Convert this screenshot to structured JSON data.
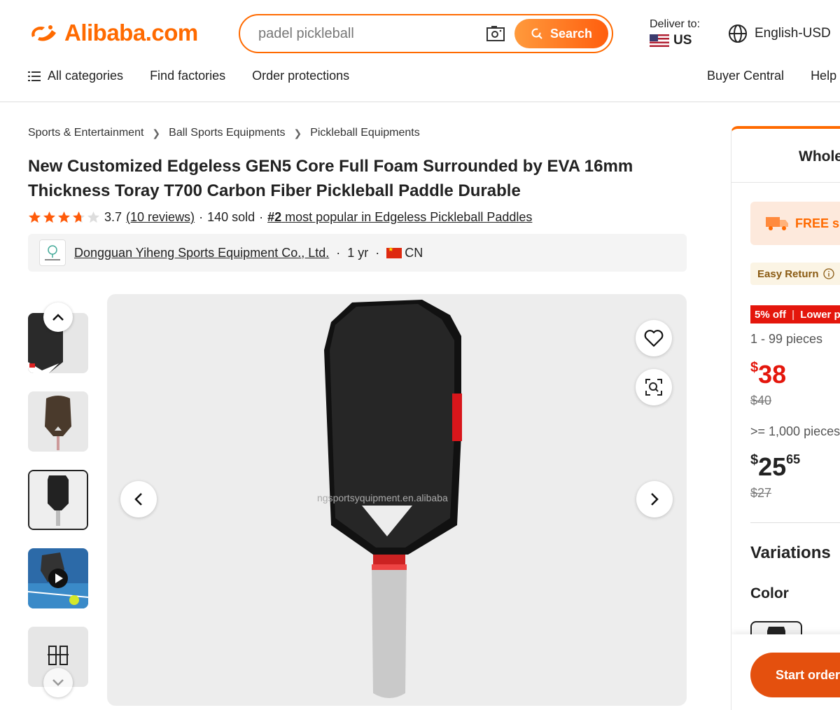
{
  "header": {
    "logo_text": "Alibaba.com",
    "search": {
      "placeholder": "padel pickleball",
      "button_label": "Search"
    },
    "deliver": {
      "label": "Deliver to:",
      "country": "US"
    },
    "language": "English-USD",
    "nav": {
      "all_categories": "All categories",
      "find_factories": "Find factories",
      "order_protections": "Order protections",
      "buyer_central": "Buyer Central",
      "help": "Help"
    }
  },
  "breadcrumb": [
    "Sports & Entertainment",
    "Ball Sports Equipments",
    "Pickleball Equipments"
  ],
  "product": {
    "title": "New Customized Edgeless GEN5 Core Full Foam Surrounded by EVA 16mm Thickness Toray T700 Carbon Fiber Pickleball Paddle Durable",
    "rating_value": 3.7,
    "rating_text": "3.7",
    "reviews": "(10 reviews)",
    "sold": "140 sold",
    "rank": "#2",
    "rank_text": "most popular in Edgeless Pickleball Paddles",
    "supplier": {
      "name": "Dongguan Yiheng Sports Equipment Co., Ltd.",
      "years": "1 yr",
      "country": "CN"
    },
    "image_watermark": "ngsportsyquipment.en.alibaba"
  },
  "panel": {
    "heading": "Whole",
    "free_shipping": "FREE s",
    "easy_return": "Easy Return",
    "promo_discount": "5% off",
    "promo_text": "Lower p",
    "tiers": [
      {
        "range": "1 - 99 pieces",
        "currency": "$",
        "price": "38",
        "cents": "",
        "old_price": "$40"
      },
      {
        "range": ">= 1,000 pieces",
        "currency": "$",
        "price": "25",
        "cents": "65",
        "old_price": "$27"
      }
    ],
    "variations_title": "Variations",
    "color_label": "Color",
    "start_order": "Start order"
  },
  "colors": {
    "brand": "#ff6a00",
    "price_red": "#e4160c",
    "star": "#ff5b0a"
  },
  "icons": [
    "camera-search-icon",
    "magnifier-icon",
    "globe-icon",
    "menu-icon",
    "chevron-right-icon",
    "heart-icon",
    "image-search-icon",
    "chevron-left-icon",
    "chevron-up-icon",
    "chevron-down-icon",
    "truck-icon",
    "info-icon",
    "play-icon"
  ]
}
